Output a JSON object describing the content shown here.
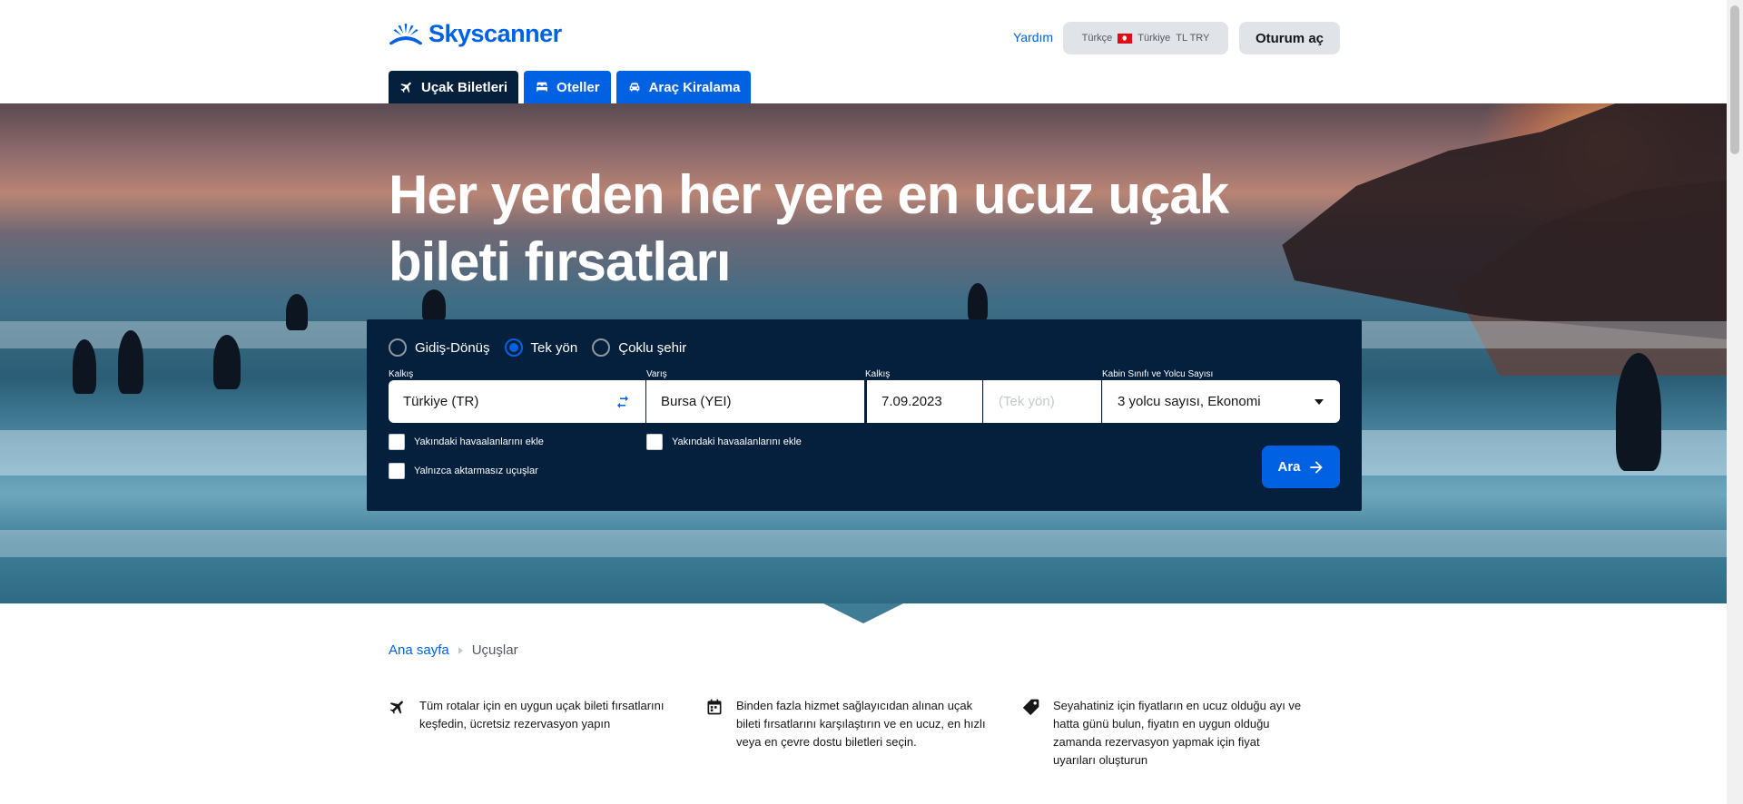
{
  "header": {
    "brand": "Skyscanner",
    "help_label": "Yardım",
    "locale": {
      "language": "Türkçe",
      "country": "Türkiye",
      "currency": "TL TRY"
    },
    "signin_label": "Oturum aç"
  },
  "tabs": [
    {
      "label": "Uçak Biletleri",
      "icon": "plane-icon",
      "active": true
    },
    {
      "label": "Oteller",
      "icon": "bed-icon",
      "active": false
    },
    {
      "label": "Araç Kiralama",
      "icon": "car-icon",
      "active": false
    }
  ],
  "hero": {
    "title": "Her yerden her yere en ucuz uçak bileti fırsatları"
  },
  "search": {
    "trip_types": [
      {
        "label": "Gidiş-Dönüş",
        "checked": false
      },
      {
        "label": "Tek yön",
        "checked": true
      },
      {
        "label": "Çoklu şehir",
        "checked": false
      }
    ],
    "from_label": "Kalkış",
    "from_value": "Türkiye (TR)",
    "to_label": "Varış",
    "to_value": "Bursa (YEI)",
    "depart_label": "Kalkış",
    "depart_value": "7.09.2023",
    "return_value": "(Tek yön)",
    "cabin_label": "Kabin Sınıfı ve Yolcu Sayısı",
    "cabin_value": "3 yolcu sayısı, Ekonomi",
    "nearby_from_label": "Yakındaki havaalanlarını ekle",
    "nearby_to_label": "Yakındaki havaalanlarını ekle",
    "direct_only_label": "Yalnızca aktarmasız uçuşlar",
    "search_button_label": "Ara"
  },
  "breadcrumb": {
    "home": "Ana sayfa",
    "current": "Uçuşlar"
  },
  "features": [
    {
      "icon": "plane-icon",
      "text": "Tüm rotalar için en uygun uçak bileti fırsatlarını keşfedin, ücretsiz rezervasyon yapın"
    },
    {
      "icon": "calendar-icon",
      "text": "Binden fazla hizmet sağlayıcıdan alınan uçak bileti fırsatlarını karşılaştırın ve en ucuz, en hızlı veya en çevre dostu biletleri seçin."
    },
    {
      "icon": "price-tag-icon",
      "text": "Seyahatiniz için fiyatların en ucuz olduğu ayı ve hatta günü bulun, fiyatın en uygun olduğu zamanda rezervasyon yapmak için fiyat uyarıları oluşturun"
    }
  ],
  "colors": {
    "brand_blue": "#0062e3",
    "navy": "#05203c"
  }
}
